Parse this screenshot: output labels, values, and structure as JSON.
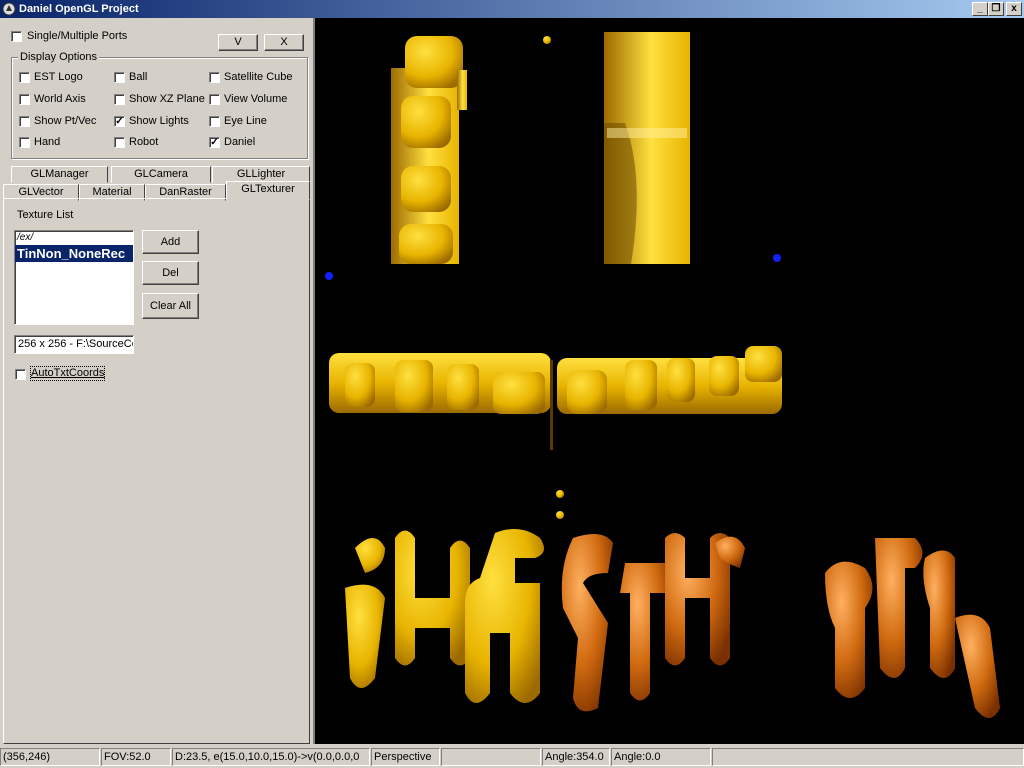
{
  "window": {
    "title": "Daniel OpenGL Project",
    "controls": [
      "_",
      "❐",
      "x"
    ]
  },
  "top": {
    "single_multiple_label": "Single/Multiple Ports",
    "v_label": "V",
    "x_label": "X"
  },
  "display_options": {
    "title": "Display Options",
    "items": [
      {
        "label": "EST Logo",
        "checked": false
      },
      {
        "label": "Ball",
        "checked": false
      },
      {
        "label": "Satellite Cube",
        "checked": false
      },
      {
        "label": "World Axis",
        "checked": false
      },
      {
        "label": "Show XZ Plane",
        "checked": false
      },
      {
        "label": "View Volume",
        "checked": false
      },
      {
        "label": "Show Pt/Vec",
        "checked": false
      },
      {
        "label": "Show Lights",
        "checked": true
      },
      {
        "label": "Eye Line",
        "checked": false
      },
      {
        "label": "Hand",
        "checked": false
      },
      {
        "label": "Robot",
        "checked": false
      },
      {
        "label": "Daniel",
        "checked": true
      }
    ]
  },
  "tabs": {
    "row1": [
      "GLManager",
      "GLCamera",
      "GLLighter"
    ],
    "row2": [
      "GLVector",
      "Material",
      "DanRaster",
      "GLTexturer"
    ],
    "active": "GLTexturer"
  },
  "texturer": {
    "list_label": "Texture List",
    "list_items": [
      "/ex/",
      "TinNon_NoneRec"
    ],
    "selected_index": 1,
    "add_label": "Add",
    "del_label": "Del",
    "clear_label": "Clear All",
    "info": "256 x 256 - F:\\SourceCo",
    "auto_coords_label": "AutoTxtCoords",
    "auto_coords_checked": false
  },
  "statusbar": [
    "(356,246)",
    "FOV:52.0",
    "D:23.5, e(15.0,10.0,15.0)->v(0.0,0.0,0",
    "Perspective",
    "",
    "Angle:354.0",
    "Angle:0.0",
    ""
  ],
  "colors": {
    "gold_light": "#ffe040",
    "gold": "#e8b400",
    "gold_dark": "#9c6a00",
    "copper": "#d06a10",
    "marker": "#1020ff"
  }
}
